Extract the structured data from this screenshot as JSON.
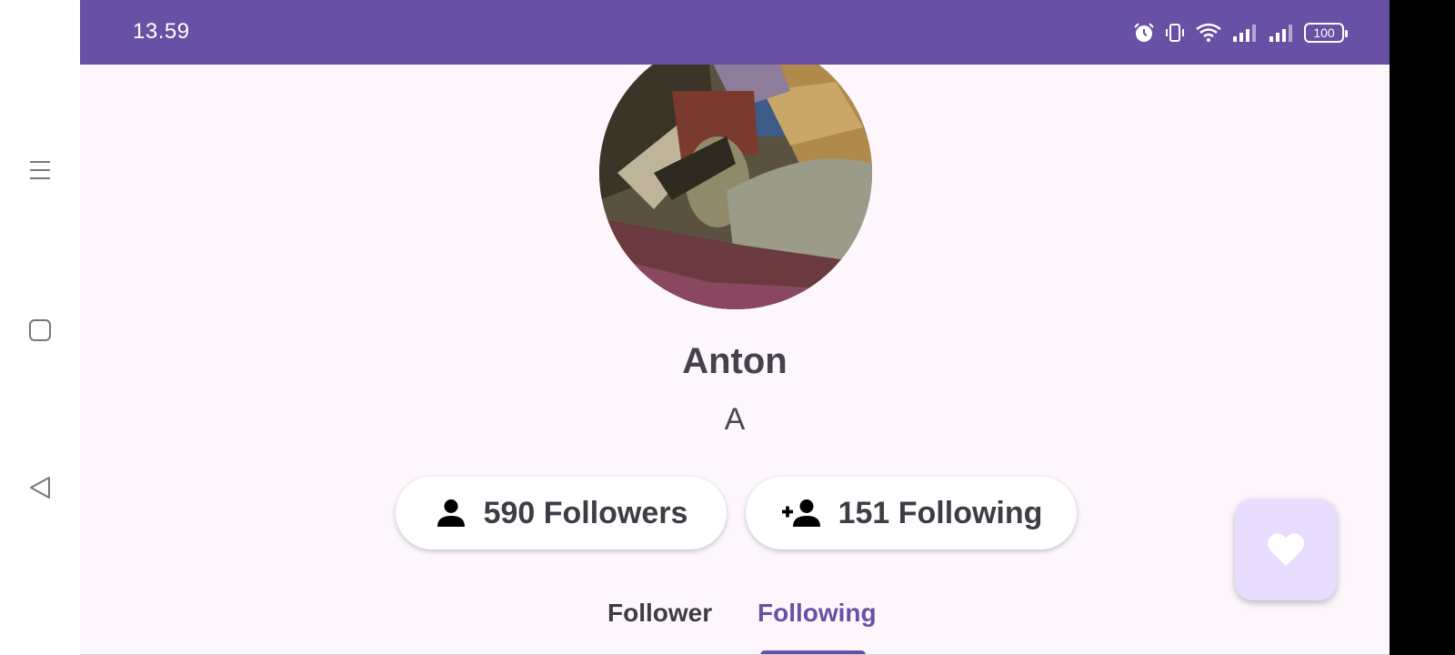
{
  "status_bar": {
    "time": "13.59",
    "battery": "100",
    "icons": [
      "alarm-icon",
      "vibrate-icon",
      "wifi-icon",
      "signal-icon",
      "signal-icon-2",
      "battery-icon"
    ]
  },
  "system_nav": {
    "buttons": [
      "menu-icon",
      "home-square-icon",
      "back-triangle-icon"
    ]
  },
  "profile": {
    "name": "Anton",
    "username": "A",
    "followers_label": "590 Followers",
    "following_label": "151 Following"
  },
  "tabs": {
    "items": [
      "Follower",
      "Following"
    ],
    "selected": "Following"
  },
  "fab": {
    "icon": "heart-icon"
  },
  "colors": {
    "accent": "#6850a4",
    "background": "#fdf7fd",
    "fab_bg": "#e9ddff",
    "text": "#45424c"
  }
}
